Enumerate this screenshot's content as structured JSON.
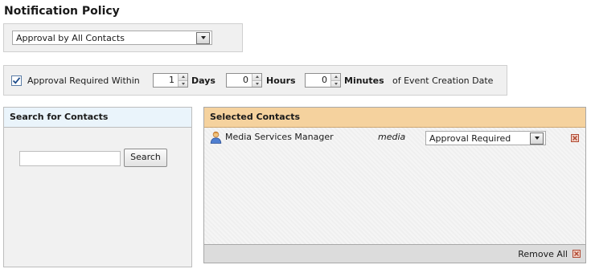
{
  "page": {
    "title": "Notification Policy"
  },
  "policy": {
    "selected": "Approval by All Contacts"
  },
  "approval": {
    "checkbox_checked": true,
    "label": "Approval Required Within",
    "days_value": "1",
    "days_label": "Days",
    "hours_value": "0",
    "hours_label": "Hours",
    "minutes_value": "0",
    "minutes_label": "Minutes",
    "suffix": "of Event Creation Date"
  },
  "search": {
    "header": "Search for Contacts",
    "input_value": "",
    "button_label": "Search"
  },
  "selected_contacts": {
    "header": "Selected Contacts",
    "rows": [
      {
        "name": "Media Services Manager",
        "username": "media",
        "role": "Approval Required"
      }
    ],
    "remove_all_label": "Remove All"
  },
  "colors": {
    "selected_header_bg": "#f5d29e",
    "search_header_bg": "#eaf4fb",
    "remove_icon": "#b04a33"
  },
  "icons": {
    "contact": "user-icon",
    "remove": "remove-x-icon",
    "check": "check-icon"
  }
}
